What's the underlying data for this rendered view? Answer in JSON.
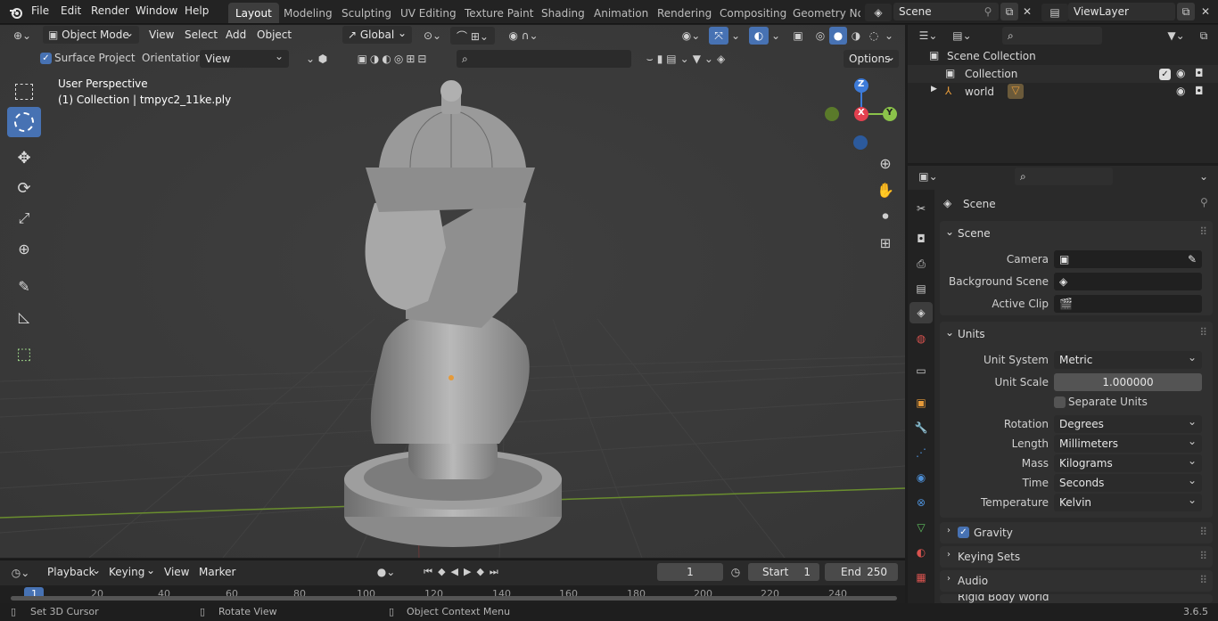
{
  "topbar": {
    "menus": [
      "File",
      "Edit",
      "Render",
      "Window",
      "Help"
    ],
    "workspaces": [
      "Layout",
      "Modeling",
      "Sculpting",
      "UV Editing",
      "Texture Paint",
      "Shading",
      "Animation",
      "Rendering",
      "Compositing",
      "Geometry Noc"
    ],
    "active_workspace": "Layout",
    "scene_name": "Scene",
    "view_layer": "ViewLayer"
  },
  "viewport_header": {
    "mode": "Object Mode",
    "menus": [
      "View",
      "Select",
      "Add",
      "Object"
    ],
    "transform_orientation": "Global",
    "surface_project_label": "Surface Project",
    "orientation_label": "Orientation:",
    "orientation_value": "View",
    "options_label": "Options"
  },
  "viewport": {
    "perspective_label": "User Perspective",
    "object_label": "(1) Collection | tmpyc2_11ke.ply",
    "gizmo": {
      "z": "Z",
      "x": "X",
      "y": "Y"
    }
  },
  "timeline": {
    "menus": [
      "Playback",
      "Keying",
      "View",
      "Marker"
    ],
    "current_frame": "1",
    "start_label": "Start",
    "start_value": "1",
    "end_label": "End",
    "end_value": "250",
    "ruler": [
      "1",
      "20",
      "40",
      "60",
      "80",
      "100",
      "120",
      "140",
      "160",
      "180",
      "200",
      "220",
      "240"
    ]
  },
  "statusbar": {
    "left": "Set 3D Cursor",
    "middle": "Rotate View",
    "right": "Object Context Menu",
    "version": "3.6.5"
  },
  "outliner": {
    "root": "Scene Collection",
    "collection": "Collection",
    "object": "world"
  },
  "properties": {
    "context_title": "Scene",
    "scene_panel": {
      "title": "Scene",
      "camera_label": "Camera",
      "background_scene_label": "Background Scene",
      "active_clip_label": "Active Clip"
    },
    "units_panel": {
      "title": "Units",
      "unit_system_label": "Unit System",
      "unit_system": "Metric",
      "unit_scale_label": "Unit Scale",
      "unit_scale": "1.000000",
      "separate_units_label": "Separate Units",
      "rotation_label": "Rotation",
      "rotation": "Degrees",
      "length_label": "Length",
      "length": "Millimeters",
      "mass_label": "Mass",
      "mass": "Kilograms",
      "time_label": "Time",
      "time": "Seconds",
      "temperature_label": "Temperature",
      "temperature": "Kelvin"
    },
    "collapsed_panels": [
      "Gravity",
      "Keying Sets",
      "Audio",
      "Rigid Body World"
    ]
  },
  "colors": {
    "accent": "#4772b3",
    "x_axis": "#e2404f",
    "y_axis": "#8bc34a",
    "z_axis": "#3d7bd9"
  }
}
